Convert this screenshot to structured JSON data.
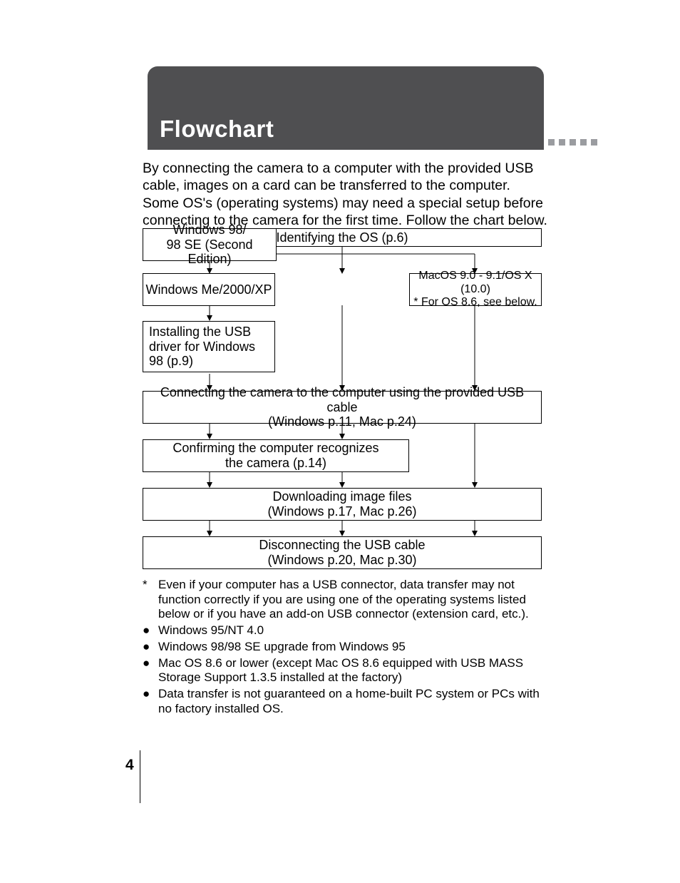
{
  "title": "Flowchart",
  "intro": "By connecting the camera to a computer with the provided USB cable, images on a card can be transferred to the computer. Some OS's (operating systems) may need a special setup before connecting to the camera for the first time. Follow the chart below.",
  "boxes": {
    "identify": "Identifying the OS (p.6)",
    "win98": "Windows 98/\n98 SE (Second Edition)",
    "winme": "Windows Me/2000/XP",
    "mac_main": "MacOS 9.0 - 9.1/OS X (10.0)",
    "mac_sub": "* For OS 8.6, see below.",
    "install": "Installing the USB driver for Windows 98 (p.9)",
    "connect": "Connecting the camera to the computer using the provided USB cable\n(Windows p.11,  Mac p.24)",
    "confirm": "Confirming the computer recognizes\nthe camera (p.14)",
    "download": "Downloading image files\n(Windows p.17,  Mac p.26)",
    "disconnect": "Disconnecting the USB cable\n(Windows p.20,  Mac p.30)"
  },
  "footnotes": {
    "star": "Even if your computer has a USB connector, data transfer may not function correctly if you are using one of the operating systems listed below or if you have an add-on USB connector (extension card, etc.).",
    "b1": "Windows 95/NT 4.0",
    "b2": "Windows 98/98 SE upgrade from Windows 95",
    "b3": "Mac OS 8.6 or lower (except Mac OS 8.6 equipped with USB MASS Storage Support 1.3.5 installed at the factory)",
    "b4": "Data transfer is not guaranteed on a home-built PC system or PCs with no factory installed OS."
  },
  "pagenum": "4"
}
